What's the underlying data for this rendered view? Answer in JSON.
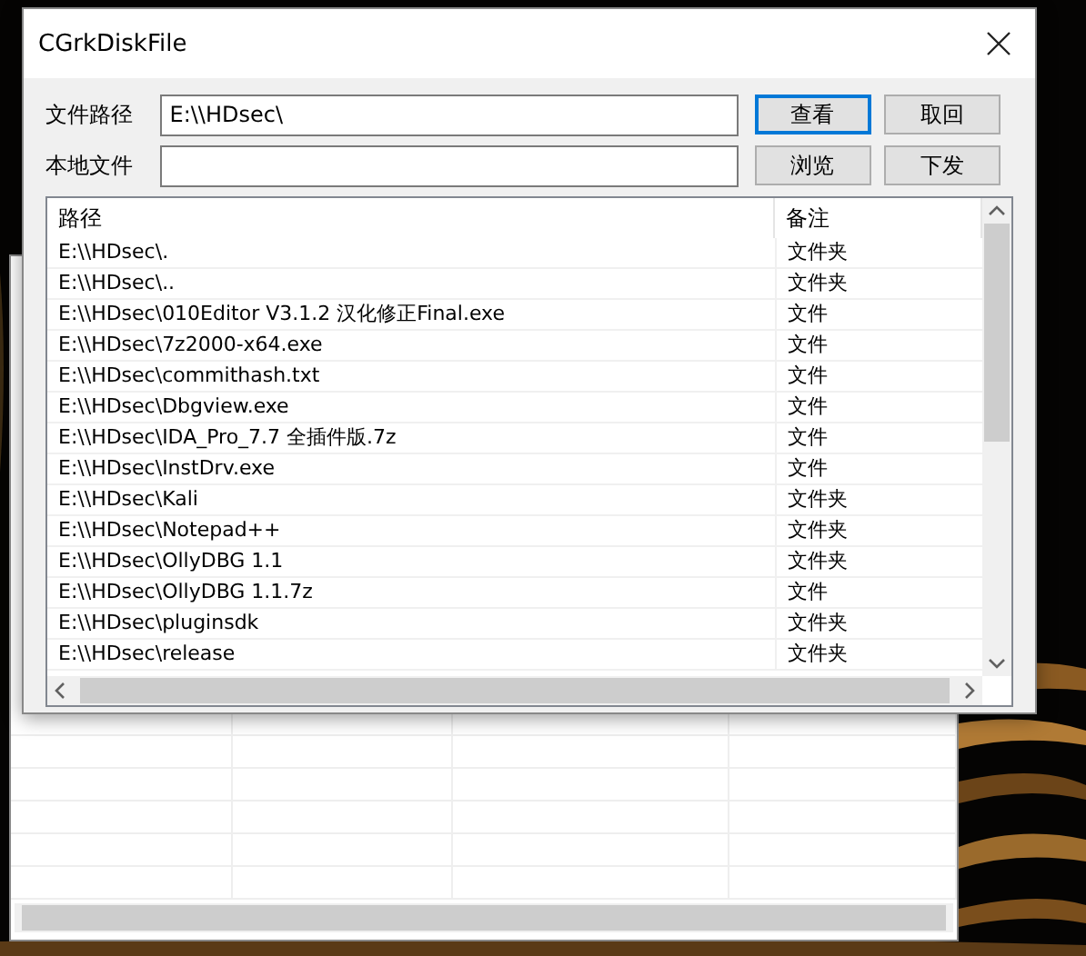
{
  "window": {
    "title": "CGrkDiskFile"
  },
  "form": {
    "fields": [
      {
        "label": "文件路径",
        "value": "E:\\\\HDsec\\"
      },
      {
        "label": "本地文件"
      }
    ],
    "buttons": [
      {
        "label": "查看",
        "focused": true
      },
      {
        "label": "取回",
        "focused": false
      },
      {
        "label": "浏览",
        "focused": false
      },
      {
        "label": "下发",
        "focused": false
      }
    ]
  },
  "file_list": {
    "columns": [
      "路径",
      "备注"
    ],
    "rows": [
      {
        "path": "E:\\\\HDsec\\.",
        "note": "文件夹"
      },
      {
        "path": "E:\\\\HDsec\\..",
        "note": "文件夹"
      },
      {
        "path": "E:\\\\HDsec\\010Editor V3.1.2 汉化修正Final.exe",
        "note": "文件"
      },
      {
        "path": "E:\\\\HDsec\\7z2000-x64.exe",
        "note": "文件"
      },
      {
        "path": "E:\\\\HDsec\\commithash.txt",
        "note": "文件"
      },
      {
        "path": "E:\\\\HDsec\\Dbgview.exe",
        "note": "文件"
      },
      {
        "path": "E:\\\\HDsec\\IDA_Pro_7.7 全插件版.7z",
        "note": "文件"
      },
      {
        "path": "E:\\\\HDsec\\InstDrv.exe",
        "note": "文件"
      },
      {
        "path": "E:\\\\HDsec\\Kali",
        "note": "文件夹"
      },
      {
        "path": "E:\\\\HDsec\\Notepad++",
        "note": "文件夹"
      },
      {
        "path": "E:\\\\HDsec\\OllyDBG 1.1",
        "note": "文件夹"
      },
      {
        "path": "E:\\\\HDsec\\OllyDBG 1.1.7z",
        "note": "文件"
      },
      {
        "path": "E:\\\\HDsec\\pluginsdk",
        "note": "文件夹"
      },
      {
        "path": "E:\\\\HDsec\\release",
        "note": "文件夹"
      }
    ]
  }
}
